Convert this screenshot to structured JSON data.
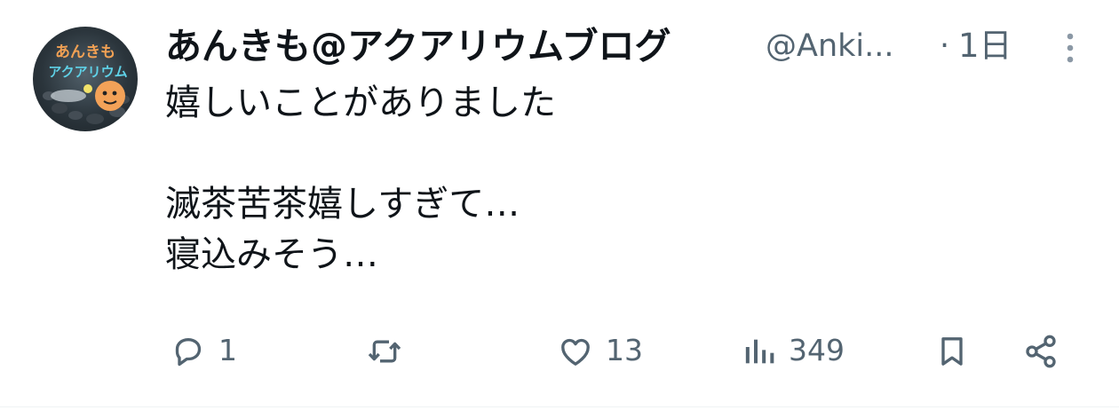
{
  "tweet": {
    "author": {
      "display_name": "あんきも@アクアリウムブログ",
      "handle": "@Anki...",
      "avatar_text_line1": "あんきも",
      "avatar_text_line2": "アクアリウム"
    },
    "separator": "·",
    "timestamp": "1日",
    "more_icon": "more-vertical-icon",
    "text_lines": [
      "嬉しいことがありました",
      "",
      "滅茶苦茶嬉しすぎて…",
      "寝込みそう…"
    ],
    "actions": {
      "reply": {
        "icon": "reply-icon",
        "count": "1"
      },
      "retweet": {
        "icon": "retweet-icon",
        "count": ""
      },
      "like": {
        "icon": "heart-icon",
        "count": "13"
      },
      "views": {
        "icon": "views-chart-icon",
        "count": "349"
      },
      "bookmark": {
        "icon": "bookmark-icon"
      },
      "share": {
        "icon": "share-icon"
      }
    }
  },
  "colors": {
    "text_primary": "#0f1419",
    "text_secondary": "#536471",
    "more_icon": "#8b98a5"
  }
}
